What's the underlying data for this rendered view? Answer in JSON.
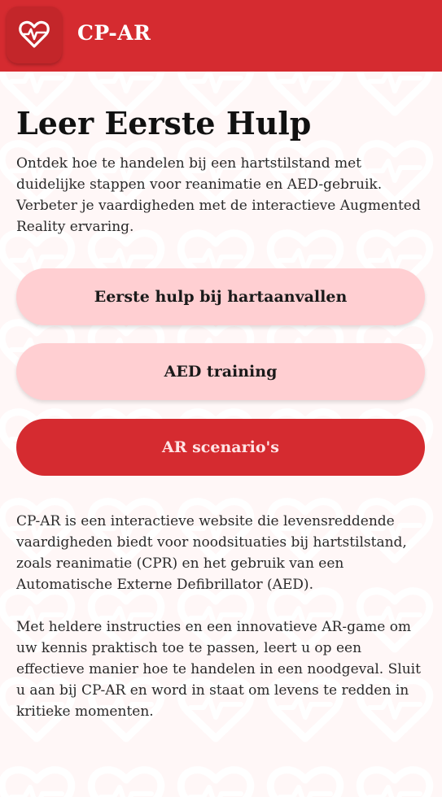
{
  "header": {
    "app_title": "CP-AR",
    "logo_icon": "heart-pulse-icon"
  },
  "main": {
    "title": "Leer Eerste Hulp",
    "intro": "Ontdek hoe te handelen bij een hartstilstand met duidelijke stappen voor reanimatie en AED-gebruik. Verbeter je vaardigheden met de interactieve Augmented Reality ervaring.",
    "buttons": [
      {
        "label": "Eerste hulp bij hartaanvallen"
      },
      {
        "label": "AED training"
      },
      {
        "label": "AR scenario's"
      }
    ],
    "description_1": "CP-AR is een interactieve website die levensreddende vaardigheden biedt voor noodsituaties bij hartstilstand, zoals reanimatie (CPR) en het gebruik van een Automatische Externe Defibrillator (AED).",
    "description_2": "Met heldere instructies en een innovatieve AR-game om uw kennis praktisch toe te passen, leert u op een effectieve manier hoe te handelen in een noodgeval. Sluit u aan bij CP-AR en word in staat om levens te redden in kritieke momenten."
  },
  "colors": {
    "brand_red": "#d52b30",
    "button_light": "#ffcfd2",
    "background": "#fff7f7"
  }
}
